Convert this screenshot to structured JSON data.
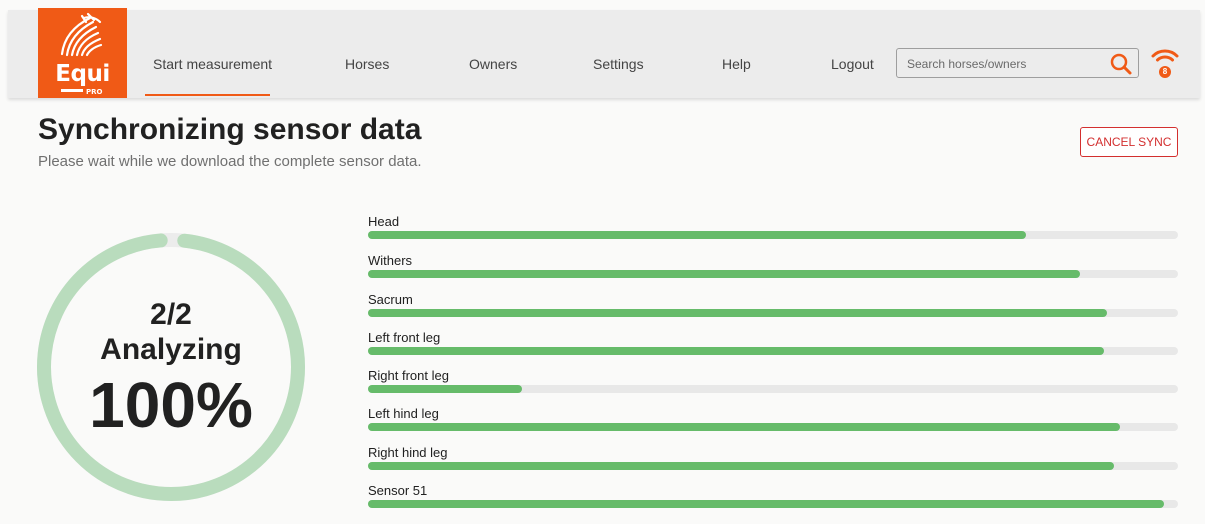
{
  "brand": {
    "name": "Equi",
    "sub": "PRO",
    "color": "#f05a16"
  },
  "nav": {
    "items": [
      {
        "label": "Start measurement",
        "active": true
      },
      {
        "label": "Horses"
      },
      {
        "label": "Owners"
      },
      {
        "label": "Settings"
      },
      {
        "label": "Help"
      },
      {
        "label": "Logout"
      }
    ],
    "search": {
      "placeholder": "Search horses/owners",
      "value": ""
    },
    "connection_count": "8"
  },
  "page": {
    "title": "Synchronizing sensor data",
    "subtitle": "Please wait while we download the complete sensor data.",
    "cancel_label": "CANCEL SYNC"
  },
  "progress": {
    "step": "2/2",
    "status": "Analyzing",
    "percent_label": "100%",
    "ring_fraction": 0.97
  },
  "sensors": [
    {
      "name": "Head",
      "progress": 0.812
    },
    {
      "name": "Withers",
      "progress": 0.879
    },
    {
      "name": "Sacrum",
      "progress": 0.912
    },
    {
      "name": "Left front leg",
      "progress": 0.909
    },
    {
      "name": "Right front leg",
      "progress": 0.19
    },
    {
      "name": "Left hind leg",
      "progress": 0.928
    },
    {
      "name": "Right hind leg",
      "progress": 0.921
    },
    {
      "name": "Sensor 51",
      "progress": 0.983
    }
  ],
  "colors": {
    "accent": "#f05a16",
    "bar_fill": "#66bb6a",
    "ring": "#b9dcbd",
    "danger": "#d32f2f"
  }
}
